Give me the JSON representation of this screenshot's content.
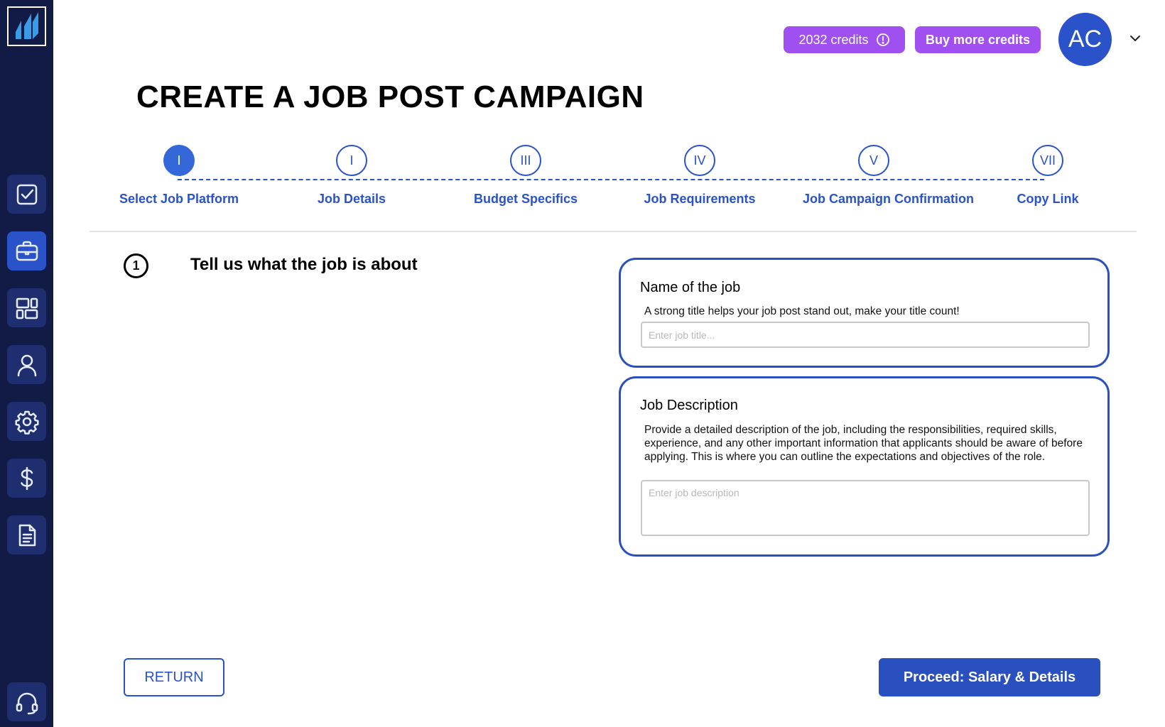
{
  "header": {
    "credits_label": "2032 credits",
    "buy_label": "Buy more credits",
    "avatar_initials": "AC"
  },
  "page": {
    "title": "CREATE A JOB POST CAMPAIGN"
  },
  "stepper": {
    "steps": [
      {
        "numeral": "I",
        "label": "Select Job Platform",
        "active": true
      },
      {
        "numeral": "I",
        "label": "Job Details",
        "active": false
      },
      {
        "numeral": "III",
        "label": "Budget Specifics",
        "active": false
      },
      {
        "numeral": "IV",
        "label": "Job Requirements",
        "active": false
      },
      {
        "numeral": "V",
        "label": "Job Campaign Confirmation",
        "active": false
      },
      {
        "numeral": "VII",
        "label": "Copy Link",
        "active": false
      }
    ]
  },
  "section": {
    "number": "1",
    "title": "Tell us what the job is about"
  },
  "job_name": {
    "heading": "Name of the job",
    "help": "A strong title helps your job post stand out, make your title count!",
    "placeholder": "Enter job title...",
    "value": ""
  },
  "job_description": {
    "heading": "Job Description",
    "help": "Provide a detailed description of the job, including the responsibilities, required skills, experience, and any other important information that applicants should be aware of before applying. This is where you can outline the expectations and objectives of the role.",
    "placeholder": "Enter job description",
    "value": ""
  },
  "footer": {
    "return_label": "RETURN",
    "proceed_label": "Proceed: Salary & Details"
  },
  "sidebar": {
    "items": [
      {
        "icon": "checkbox-icon",
        "active": false
      },
      {
        "icon": "briefcase-icon",
        "active": true
      },
      {
        "icon": "dashboard-icon",
        "active": false
      },
      {
        "icon": "user-icon",
        "active": false
      },
      {
        "icon": "gear-icon",
        "active": false
      },
      {
        "icon": "dollar-icon",
        "active": false
      },
      {
        "icon": "document-icon",
        "active": false
      },
      {
        "icon": "headset-icon",
        "active": false
      }
    ]
  },
  "colors": {
    "sidebar_bg": "#121b45",
    "primary": "#2a52c9",
    "credits_purple": "#a04ff0"
  }
}
